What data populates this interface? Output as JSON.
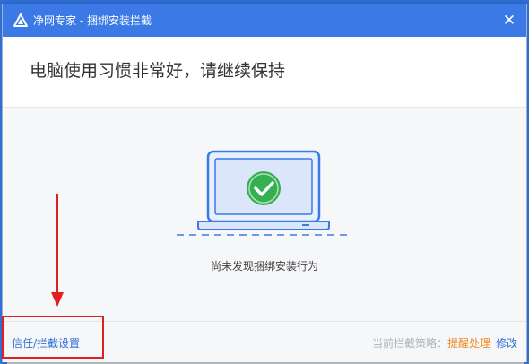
{
  "dialog": {
    "title": "净网专家 - 捆绑安装拦截",
    "close_glyph": "✕"
  },
  "header": {
    "heading": "电脑使用习惯非常好，请继续保持"
  },
  "main": {
    "status_text": "尚未发现捆绑安装行为",
    "illustration_icon": "laptop-check-icon"
  },
  "footer": {
    "trust_link": "信任/拦截设置",
    "policy_label": "当前拦截策略：",
    "policy_value": "提醒处理",
    "modify_label": "修改"
  },
  "colors": {
    "titlebar": "#3b7ae6",
    "link": "#2f6fd8",
    "check_green": "#35b050",
    "annotation_red": "#e02020",
    "policy_orange": "#f08a24"
  }
}
